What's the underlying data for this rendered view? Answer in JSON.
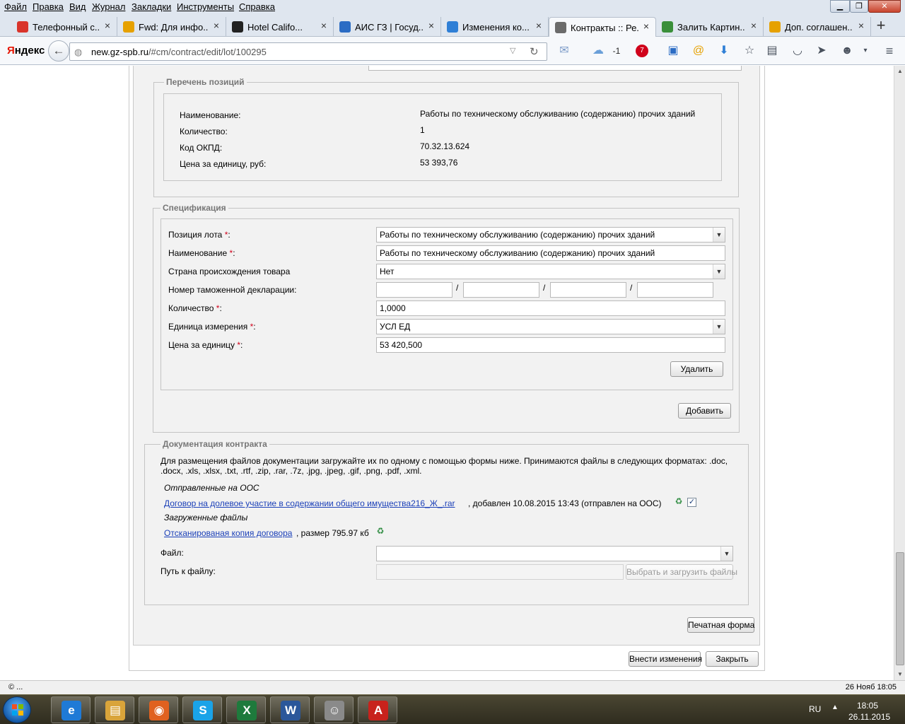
{
  "menubar": {
    "items": [
      "Файл",
      "Правка",
      "Вид",
      "Журнал",
      "Закладки",
      "Инструменты",
      "Справка"
    ]
  },
  "tabs": [
    {
      "label": "Телефонный с...",
      "icon": "phone-favicon",
      "color": "#d9342b"
    },
    {
      "label": "Fwd: Для инфо...",
      "icon": "mail-at-favicon",
      "color": "#e6a100"
    },
    {
      "label": "Hotel Califo...",
      "icon": "youtube-play-favicon",
      "color": "#222222"
    },
    {
      "label": "АИС ГЗ | Госуд...",
      "icon": "ais-favicon",
      "color": "#2b6cc4"
    },
    {
      "label": "Изменения ко...",
      "icon": "help-favicon",
      "color": "#2f7fd6"
    },
    {
      "label": "Контракты :: Ре...",
      "icon": "tools-favicon",
      "color": "#6b6b6b"
    },
    {
      "label": "Залить Картин...",
      "icon": "image-favicon",
      "color": "#3a8f3a"
    },
    {
      "label": "Доп. соглашен...",
      "icon": "mail-at-favicon",
      "color": "#e6a100"
    }
  ],
  "nav": {
    "logo": "Яндекс",
    "url_host": "new.gz-spb.ru",
    "url_path": "/#cm/contract/edit/lot/100295",
    "weather": "-1",
    "badge_count": "7"
  },
  "positions": {
    "legend": "Перечень позиций",
    "rows": [
      {
        "label": "Наименование:",
        "value": "Работы по техническому обслуживанию (содержанию) прочих зданий"
      },
      {
        "label": "Количество:",
        "value": "1"
      },
      {
        "label": "Код ОКПД:",
        "value": "70.32.13.624"
      },
      {
        "label": "Цена за единицу, руб:",
        "value": "53 393,76"
      }
    ]
  },
  "spec": {
    "legend": "Спецификация",
    "lot_position_label": "Позиция лота",
    "lot_position_value": "Работы по техническому обслуживанию (содержанию) прочих зданий",
    "name_label": "Наименование",
    "name_value": "Работы по техническому обслуживанию (содержанию) прочих зданий",
    "country_label": "Страна происхождения товара",
    "country_value": "Нет",
    "customs_label": "Номер таможенной декларации:",
    "customs_sep": "/",
    "qty_label": "Количество",
    "qty_value": "1,0000",
    "unit_label": "Единица измерения",
    "unit_value": "УСЛ ЕД",
    "price_label": "Цена за единицу",
    "price_value": "53 420,500",
    "req_mark": "*",
    "colon": ":",
    "delete_label": "Удалить",
    "add_label": "Добавить"
  },
  "docs": {
    "legend": "Документация контракта",
    "note": "Для размещения файлов документации загружайте их по одному с помощью формы ниже. Принимаются файлы в следующих форматах: .doc, .docx, .xls, .xlsx, .txt, .rtf, .zip, .rar, .7z, .jpg, .jpeg, .gif, .png, .pdf, .xml.",
    "sent_heading": "Отправленные на ООС",
    "sent_file_link": "Договор на долевое участие в содержании общего имущества216_Ж_.rar",
    "sent_file_meta": ", добавлен 10.08.2015 13:43 (отправлен на ООС)",
    "uploaded_heading": "Загруженные файлы",
    "uploaded_file_link": "Отсканированая копия договора",
    "uploaded_file_meta": ", размер 795.97 кб",
    "file_label": "Файл:",
    "path_label": "Путь к файлу:",
    "upload_button": "Выбрать и загрузить файлы"
  },
  "footer": {
    "print_label": "Печатная форма",
    "save_label": "Внести изменения",
    "close_label": "Закрыть"
  },
  "statusbar": {
    "left": "© ...",
    "right": "26 Нояб 18:05"
  },
  "taskbar": {
    "apps": [
      {
        "icon": "internet-explorer-icon",
        "glyph": "e",
        "color": "#1f7ad6"
      },
      {
        "icon": "file-explorer-icon",
        "glyph": "▤",
        "color": "#d9a43a"
      },
      {
        "icon": "firefox-icon",
        "glyph": "◉",
        "color": "#e0611f"
      },
      {
        "icon": "skype-icon",
        "glyph": "S",
        "color": "#1aa3e8"
      },
      {
        "icon": "excel-icon",
        "glyph": "X",
        "color": "#1e7a3c"
      },
      {
        "icon": "word-icon",
        "glyph": "W",
        "color": "#2b579a"
      },
      {
        "icon": "scholar-app-icon",
        "glyph": "☺",
        "color": "#8a8a8a"
      },
      {
        "icon": "acrobat-icon",
        "glyph": "A",
        "color": "#c8221c"
      }
    ],
    "lang": "RU",
    "time": "18:05",
    "date": "26.11.2015"
  }
}
